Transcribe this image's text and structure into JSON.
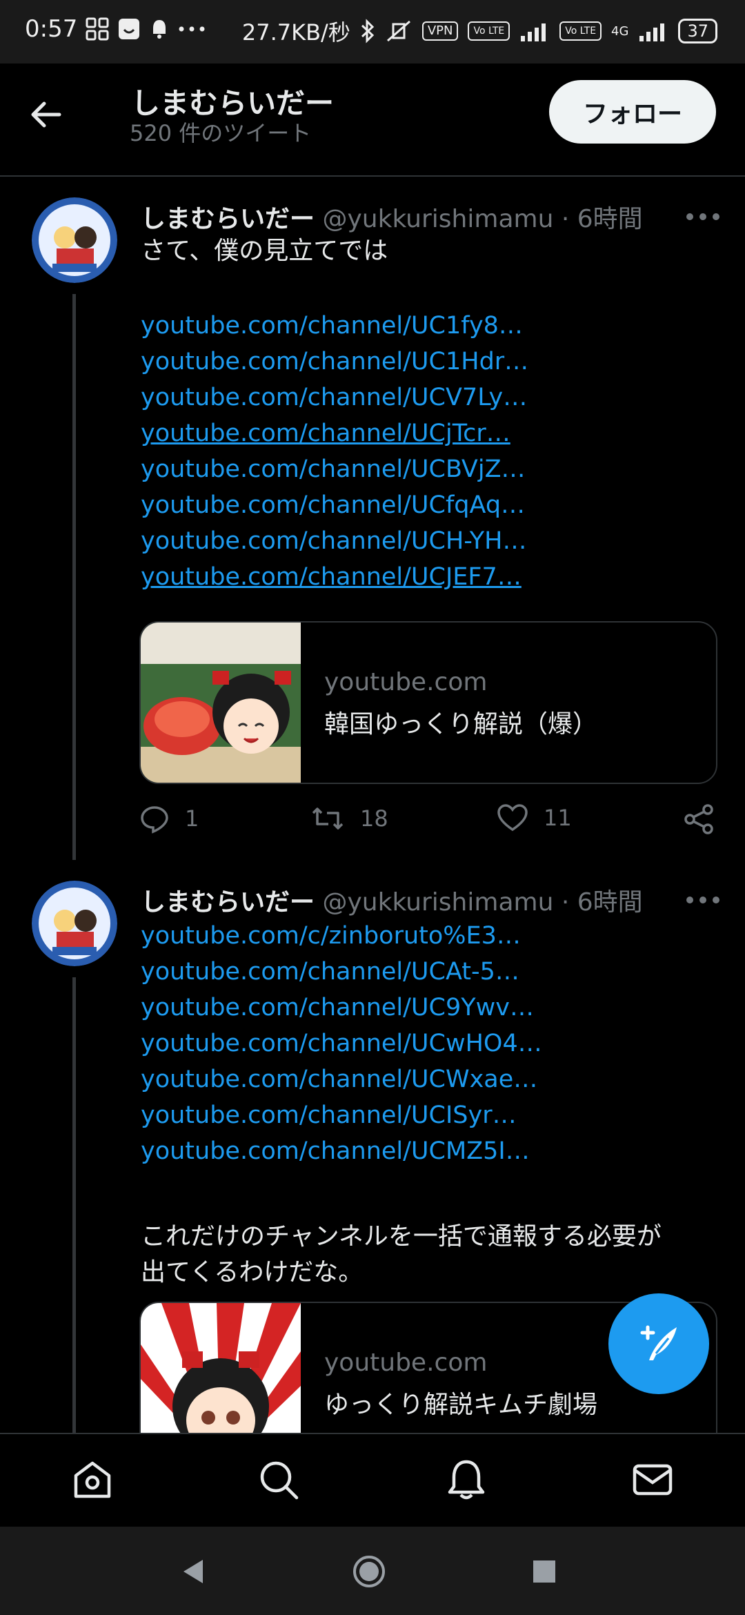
{
  "status_bar": {
    "time": "0:57",
    "speed": "27.7KB/秒",
    "vpn": "VPN",
    "volte1": "Vo LTE",
    "volte2": "Vo LTE",
    "network": "4G",
    "battery": "37"
  },
  "header": {
    "title": "しまむらいだー",
    "subtitle": "520 件のツイート",
    "follow_label": "フォロー"
  },
  "tweets": [
    {
      "name": "しまむらいだー",
      "handle": "@yukkurishimamu",
      "separator": "·",
      "time": "6時間",
      "text": "さて、僕の見立てでは",
      "links": [
        "youtube.com/channel/UC1fy8…",
        "youtube.com/channel/UC1Hdr…",
        "youtube.com/channel/UCV7Ly…",
        "youtube.com/channel/UCjTcr…",
        "youtube.com/channel/UCBVjZ…",
        "youtube.com/channel/UCfqAq…",
        "youtube.com/channel/UCH-YH…",
        "youtube.com/channel/UCJEF7…"
      ],
      "card": {
        "domain": "youtube.com",
        "title": "韓国ゆっくり解説（爆）"
      },
      "replies": "1",
      "retweets": "18",
      "likes": "11"
    },
    {
      "name": "しまむらいだー",
      "handle": "@yukkurishimamu",
      "separator": "·",
      "time": "6時間",
      "links": [
        "youtube.com/c/zinboruto%E3…",
        "youtube.com/channel/UCAt-5…",
        "youtube.com/channel/UC9Ywv…",
        "youtube.com/channel/UCwHO4…",
        "youtube.com/channel/UCWxae…",
        "youtube.com/channel/UCISyr…",
        "youtube.com/channel/UCMZ5I…"
      ],
      "text_line1": "これだけのチャンネルを一括で通報する必要が",
      "text_line2": "出てくるわけだな。",
      "card": {
        "domain": "youtube.com",
        "title": "ゆっくり解説キムチ劇場"
      }
    }
  ],
  "colors": {
    "accent": "#1d9bf0",
    "background": "#000000",
    "secondary_text": "#71767b"
  },
  "icons": {
    "header": "back-arrow-icon",
    "nav": [
      "home-icon",
      "search-icon",
      "notifications-icon",
      "messages-icon"
    ],
    "system": [
      "back-triangle-icon",
      "home-circle-icon",
      "recents-square-icon"
    ],
    "fab": "compose-tweet-icon"
  }
}
